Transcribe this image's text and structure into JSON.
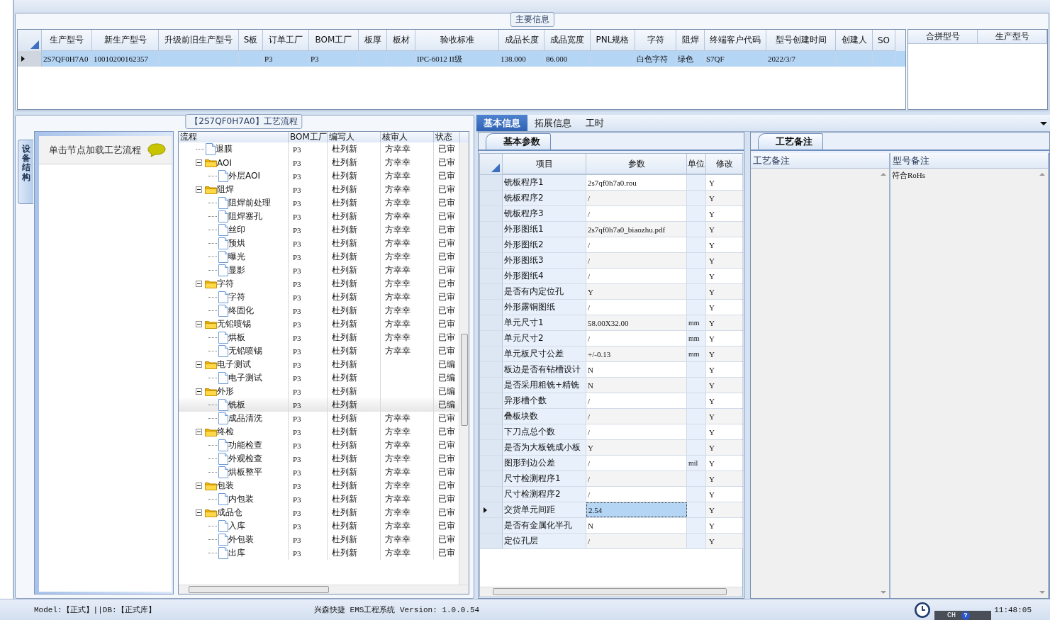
{
  "main_info": {
    "title": "主要信息",
    "columns": [
      "生产型号",
      "新生产型号",
      "升级前旧生产型号",
      "S板",
      "订单工厂",
      "BOM工厂",
      "板厚",
      "板材",
      "验收标准",
      "成品长度",
      "成品宽度",
      "PNL规格",
      "字符",
      "阻焊",
      "终端客户代码",
      "型号创建时间",
      "创建人",
      "SO"
    ],
    "rows": [
      {
        "selected": true,
        "cells": [
          "2S7QF0H7A0",
          "10010200162357",
          null,
          null,
          "P3",
          "P3",
          null,
          null,
          "IPC-6012 II级",
          "138.000",
          "86.000",
          null,
          "白色字符",
          "绿色",
          "S7QF",
          "2022/3/7",
          null,
          null
        ]
      }
    ],
    "side_columns": [
      "合拼型号",
      "生产型号"
    ]
  },
  "process": {
    "title": "【2S7QF0H7A0】工艺流程",
    "side_tab": "设备结构",
    "hint": "单击节点加载工艺流程",
    "columns": [
      "流程",
      "BOM工厂",
      "编写人",
      "核审人",
      "状态"
    ],
    "tree": [
      {
        "kind": "file",
        "label": "退膜",
        "bom": "P3",
        "writer": "杜列新",
        "reviewer": "方幸幸",
        "status": "已审",
        "selected": false
      },
      {
        "kind": "folder",
        "label": "AOI",
        "bom": "P3",
        "writer": "杜列新",
        "reviewer": "方幸幸",
        "status": "已审",
        "expanded": true,
        "selected": false,
        "children": [
          {
            "kind": "file",
            "label": "外层AOI",
            "bom": "P3",
            "writer": "杜列新",
            "reviewer": "方幸幸",
            "status": "已审",
            "selected": false
          }
        ]
      },
      {
        "kind": "folder",
        "label": "阻焊",
        "bom": "P3",
        "writer": "杜列新",
        "reviewer": "方幸幸",
        "status": "已审",
        "expanded": true,
        "selected": false,
        "children": [
          {
            "kind": "file",
            "label": "阻焊前处理",
            "bom": "P3",
            "writer": "杜列新",
            "reviewer": "方幸幸",
            "status": "已审",
            "selected": false
          },
          {
            "kind": "file",
            "label": "阻焊塞孔",
            "bom": "P3",
            "writer": "杜列新",
            "reviewer": "方幸幸",
            "status": "已审",
            "selected": false
          },
          {
            "kind": "file",
            "label": "丝印",
            "bom": "P3",
            "writer": "杜列新",
            "reviewer": "方幸幸",
            "status": "已审",
            "selected": false
          },
          {
            "kind": "file",
            "label": "预烘",
            "bom": "P3",
            "writer": "杜列新",
            "reviewer": "方幸幸",
            "status": "已审",
            "selected": false
          },
          {
            "kind": "file",
            "label": "曝光",
            "bom": "P3",
            "writer": "杜列新",
            "reviewer": "方幸幸",
            "status": "已审",
            "selected": false
          },
          {
            "kind": "file",
            "label": "显影",
            "bom": "P3",
            "writer": "杜列新",
            "reviewer": "方幸幸",
            "status": "已审",
            "selected": false
          }
        ]
      },
      {
        "kind": "folder",
        "label": "字符",
        "bom": "P3",
        "writer": "杜列新",
        "reviewer": "方幸幸",
        "status": "已审",
        "expanded": true,
        "selected": false,
        "children": [
          {
            "kind": "file",
            "label": "字符",
            "bom": "P3",
            "writer": "杜列新",
            "reviewer": "方幸幸",
            "status": "已审",
            "selected": false
          },
          {
            "kind": "file",
            "label": "终固化",
            "bom": "P3",
            "writer": "杜列新",
            "reviewer": "方幸幸",
            "status": "已审",
            "selected": false
          }
        ]
      },
      {
        "kind": "folder",
        "label": "无铅喷锡",
        "bom": "P3",
        "writer": "杜列新",
        "reviewer": "方幸幸",
        "status": "已审",
        "expanded": true,
        "selected": false,
        "children": [
          {
            "kind": "file",
            "label": "烘板",
            "bom": "P3",
            "writer": "杜列新",
            "reviewer": "方幸幸",
            "status": "已审",
            "selected": false
          },
          {
            "kind": "file",
            "label": "无铅喷锡",
            "bom": "P3",
            "writer": "杜列新",
            "reviewer": "方幸幸",
            "status": "已审",
            "selected": false
          }
        ]
      },
      {
        "kind": "folder",
        "label": "电子测试",
        "bom": "P3",
        "writer": "杜列新",
        "status": "已编",
        "expanded": true,
        "selected": false,
        "children": [
          {
            "kind": "file",
            "label": "电子测试",
            "bom": "P3",
            "writer": "杜列新",
            "status": "已编",
            "selected": false
          }
        ]
      },
      {
        "kind": "folder",
        "label": "外形",
        "bom": "P3",
        "writer": "杜列新",
        "status": "已编",
        "expanded": true,
        "selected": false,
        "children": [
          {
            "kind": "file",
            "label": "铣板",
            "bom": "P3",
            "writer": "杜列新",
            "status": "已编",
            "selected": true
          },
          {
            "kind": "file",
            "label": "成品清洗",
            "bom": "P3",
            "writer": "杜列新",
            "reviewer": "方幸幸",
            "status": "已审",
            "selected": false
          }
        ]
      },
      {
        "kind": "folder",
        "label": "终检",
        "bom": "P3",
        "writer": "杜列新",
        "reviewer": "方幸幸",
        "status": "已审",
        "expanded": true,
        "selected": false,
        "children": [
          {
            "kind": "file",
            "label": "功能检查",
            "bom": "P3",
            "writer": "杜列新",
            "reviewer": "方幸幸",
            "status": "已审",
            "selected": false
          },
          {
            "kind": "file",
            "label": "外观检查",
            "bom": "P3",
            "writer": "杜列新",
            "reviewer": "方幸幸",
            "status": "已审",
            "selected": false
          },
          {
            "kind": "file",
            "label": "烘板整平",
            "bom": "P3",
            "writer": "杜列新",
            "reviewer": "方幸幸",
            "status": "已审",
            "selected": false
          }
        ]
      },
      {
        "kind": "folder",
        "label": "包装",
        "bom": "P3",
        "writer": "杜列新",
        "reviewer": "方幸幸",
        "status": "已审",
        "expanded": true,
        "selected": false,
        "children": [
          {
            "kind": "file",
            "label": "内包装",
            "bom": "P3",
            "writer": "杜列新",
            "reviewer": "方幸幸",
            "status": "已审",
            "selected": false
          }
        ]
      },
      {
        "kind": "folder",
        "label": "成品仓",
        "bom": "P3",
        "writer": "杜列新",
        "reviewer": "方幸幸",
        "status": "已审",
        "expanded": true,
        "selected": false,
        "children": [
          {
            "kind": "file",
            "label": "入库",
            "bom": "P3",
            "writer": "杜列新",
            "reviewer": "方幸幸",
            "status": "已审",
            "selected": false
          },
          {
            "kind": "file",
            "label": "外包装",
            "bom": "P3",
            "writer": "杜列新",
            "reviewer": "方幸幸",
            "status": "已审",
            "selected": false
          },
          {
            "kind": "file",
            "label": "出库",
            "bom": "P3",
            "writer": "杜列新",
            "reviewer": "方幸幸",
            "status": "已审",
            "selected": false
          }
        ]
      }
    ]
  },
  "detail": {
    "tabs": [
      {
        "label": "基本信息",
        "selected": true
      },
      {
        "label": "拓展信息",
        "selected": false
      },
      {
        "label": "工时",
        "selected": false
      }
    ],
    "params": {
      "tab": "基本参数",
      "columns": [
        "项目",
        "参数",
        "单位",
        "修改"
      ],
      "rows": [
        {
          "item": "铣板程序1",
          "value": "2s7qf0h7a0.rou",
          "modify": "Y",
          "selected": false
        },
        {
          "item": "铣板程序2",
          "value": "/",
          "modify": "Y",
          "selected": false
        },
        {
          "item": "铣板程序3",
          "value": "/",
          "modify": "Y",
          "selected": false
        },
        {
          "item": "外形图纸1",
          "value": "2s7qf0h7a0_biaozhu.pdf",
          "modify": "Y",
          "selected": false
        },
        {
          "item": "外形图纸2",
          "value": "/",
          "modify": "Y",
          "selected": false
        },
        {
          "item": "外形图纸3",
          "value": "/",
          "modify": "Y",
          "selected": false
        },
        {
          "item": "外形图纸4",
          "value": "/",
          "modify": "Y",
          "selected": false
        },
        {
          "item": "是否有内定位孔",
          "value": "Y",
          "modify": "Y",
          "selected": false
        },
        {
          "item": "外形露铜图纸",
          "value": "/",
          "modify": "Y",
          "selected": false
        },
        {
          "item": "单元尺寸1",
          "value": "58.00X32.00",
          "unit": "mm",
          "modify": "Y",
          "selected": false
        },
        {
          "item": "单元尺寸2",
          "value": "/",
          "unit": "mm",
          "modify": "Y",
          "selected": false
        },
        {
          "item": "单元板尺寸公差",
          "value": "+/-0.13",
          "unit": "mm",
          "modify": "Y",
          "selected": false
        },
        {
          "item": "板边是否有钻槽设计",
          "value": "N",
          "modify": "Y",
          "selected": false
        },
        {
          "item": "是否采用粗铣+精铣",
          "value": "N",
          "modify": "Y",
          "selected": false
        },
        {
          "item": "异形槽个数",
          "value": "/",
          "modify": "Y",
          "selected": false
        },
        {
          "item": "叠板块数",
          "value": "/",
          "modify": "Y",
          "selected": false
        },
        {
          "item": "下刀点总个数",
          "value": "/",
          "modify": "Y",
          "selected": false
        },
        {
          "item": "是否为大板铣成小板",
          "value": "Y",
          "modify": "Y",
          "selected": false
        },
        {
          "item": "图形到边公差",
          "value": "/",
          "unit": "mil",
          "modify": "Y",
          "selected": false
        },
        {
          "item": "尺寸检测程序1",
          "value": "/",
          "modify": "Y",
          "selected": false
        },
        {
          "item": "尺寸检测程序2",
          "value": "/",
          "modify": "Y",
          "selected": false
        },
        {
          "item": "交货单元间距",
          "value": "2.54",
          "modify": "Y",
          "selected": true
        },
        {
          "item": "是否有金属化半孔",
          "value": "N",
          "modify": "Y",
          "selected": false
        },
        {
          "item": "定位孔层",
          "value": "/",
          "modify": "Y",
          "selected": false
        }
      ]
    },
    "notes": {
      "tab": "工艺备注",
      "columns": [
        "工艺备注",
        "型号备注"
      ],
      "model_note": "符合RoHs"
    }
  },
  "status_bar": {
    "mode": "Model:【正式】||DB:【正式库】",
    "app": "兴森快捷 EMS工程系统 Version: 1.0.0.54",
    "time": "11:48:05",
    "ime": "CH",
    "ime_help": "?"
  }
}
